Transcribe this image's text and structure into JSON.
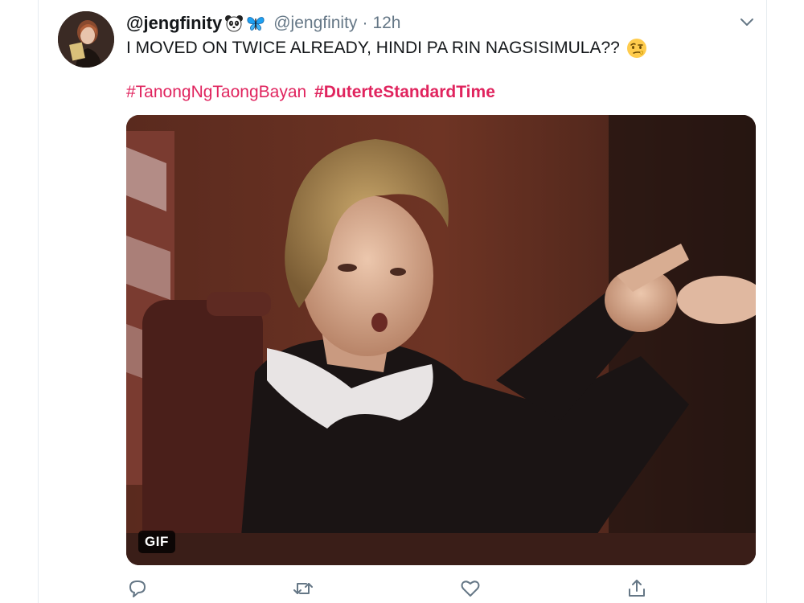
{
  "tweet": {
    "display_name": "@jengfinity",
    "handle": "@jengfinity",
    "separator": "·",
    "time": "12h",
    "text": "I MOVED ON TWICE ALREADY, HINDI PA RIN NAGSISIMULA??",
    "hashtags": [
      "#TanongNgTaongBayan",
      "#DuterteStandardTime"
    ],
    "media": {
      "badge": "GIF"
    }
  },
  "icons": {
    "name_emoji_1": "panda-icon",
    "name_emoji_2": "butterfly-icon",
    "text_emoji": "face-with-raised-eyebrow-icon",
    "menu": "chevron-down-icon",
    "actions": [
      "reply-icon",
      "retweet-icon",
      "like-icon",
      "share-icon"
    ]
  },
  "colors": {
    "hashtag": "#e0245e",
    "secondary_text": "#657786",
    "icon": "#657786",
    "butterfly": "#1da1f2"
  }
}
